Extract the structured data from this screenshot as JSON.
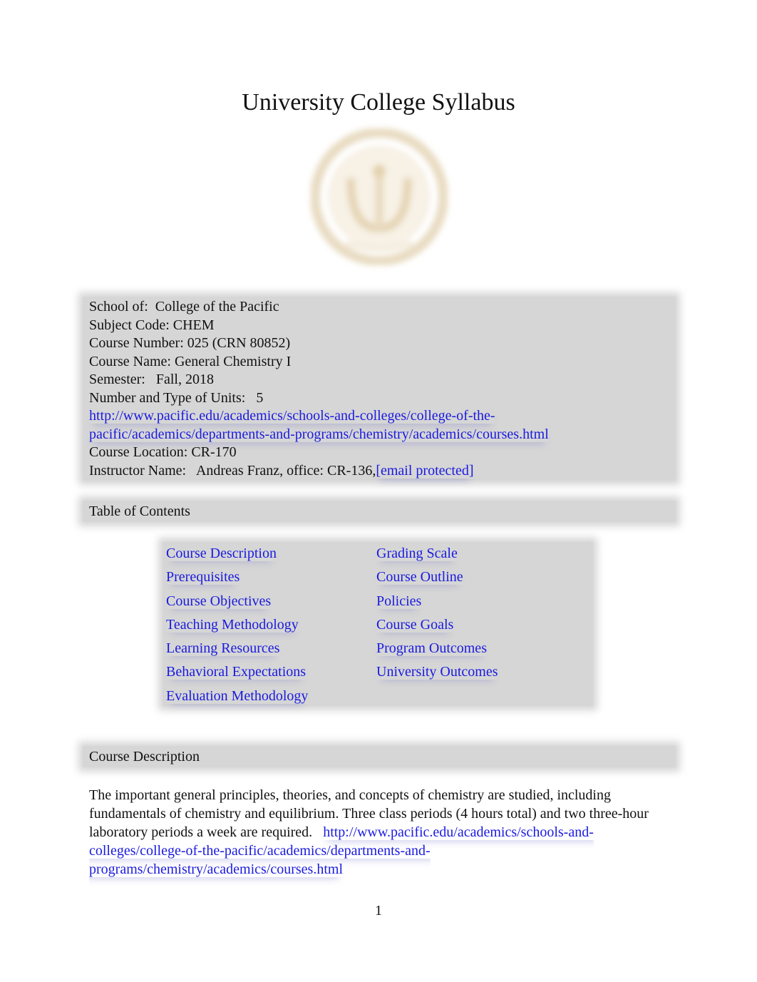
{
  "document": {
    "title": "University College Syllabus",
    "seal_icon": "university-seal-icon",
    "seal_color": "#e8dcc4"
  },
  "info": {
    "school_label": "School of:",
    "school_value": "College of the Pacific",
    "subject_label": "Subject Code:",
    "subject_value": "CHEM",
    "course_number_label": "Course Number:",
    "course_number_value": "025 (CRN 80852)",
    "course_name_label": "Course Name:",
    "course_name_value": "General Chemistry I",
    "semester_label": "Semester:",
    "semester_value": "Fall, 2018",
    "units_label": "Number and Type of Units:",
    "units_value": "5",
    "url_line1": "http://www.pacific.edu/academics/schools-and-colleges/college-of-the-",
    "url_line2": "pacific/academics/departments-and-programs/chemistry/academics/courses.html",
    "location_label": "Course Location:",
    "location_value": "CR-170",
    "instructor_label": "Instructor Name:",
    "instructor_value": "Andreas Franz, office: CR-136,",
    "email_link": "[email protected]"
  },
  "toc": {
    "heading": "Table of Contents",
    "left": [
      "Course Description",
      "Prerequisites",
      "Course Objectives",
      "Teaching Methodology",
      "Learning Resources",
      "Behavioral Expectations",
      "Evaluation Methodology"
    ],
    "right": [
      "Grading Scale",
      "Course Outline",
      "Policies",
      "Course Goals",
      "Program Outcomes",
      "University Outcomes"
    ]
  },
  "course_description": {
    "heading": "Course Description",
    "text": "The important general principles, theories, and concepts of chemistry are studied, including fundamentals of chemistry and equilibrium. Three class periods (4 hours total) and two three-hour laboratory periods a week are required.",
    "link": "http://www.pacific.edu/academics/schools-and-colleges/college-of-the-pacific/academics/departments-and-programs/chemistry/academics/courses.html"
  },
  "footer": {
    "page_number": "1"
  },
  "colors": {
    "link": "#1a1ae0",
    "shade": "#d6d6d6",
    "text": "#111111"
  }
}
